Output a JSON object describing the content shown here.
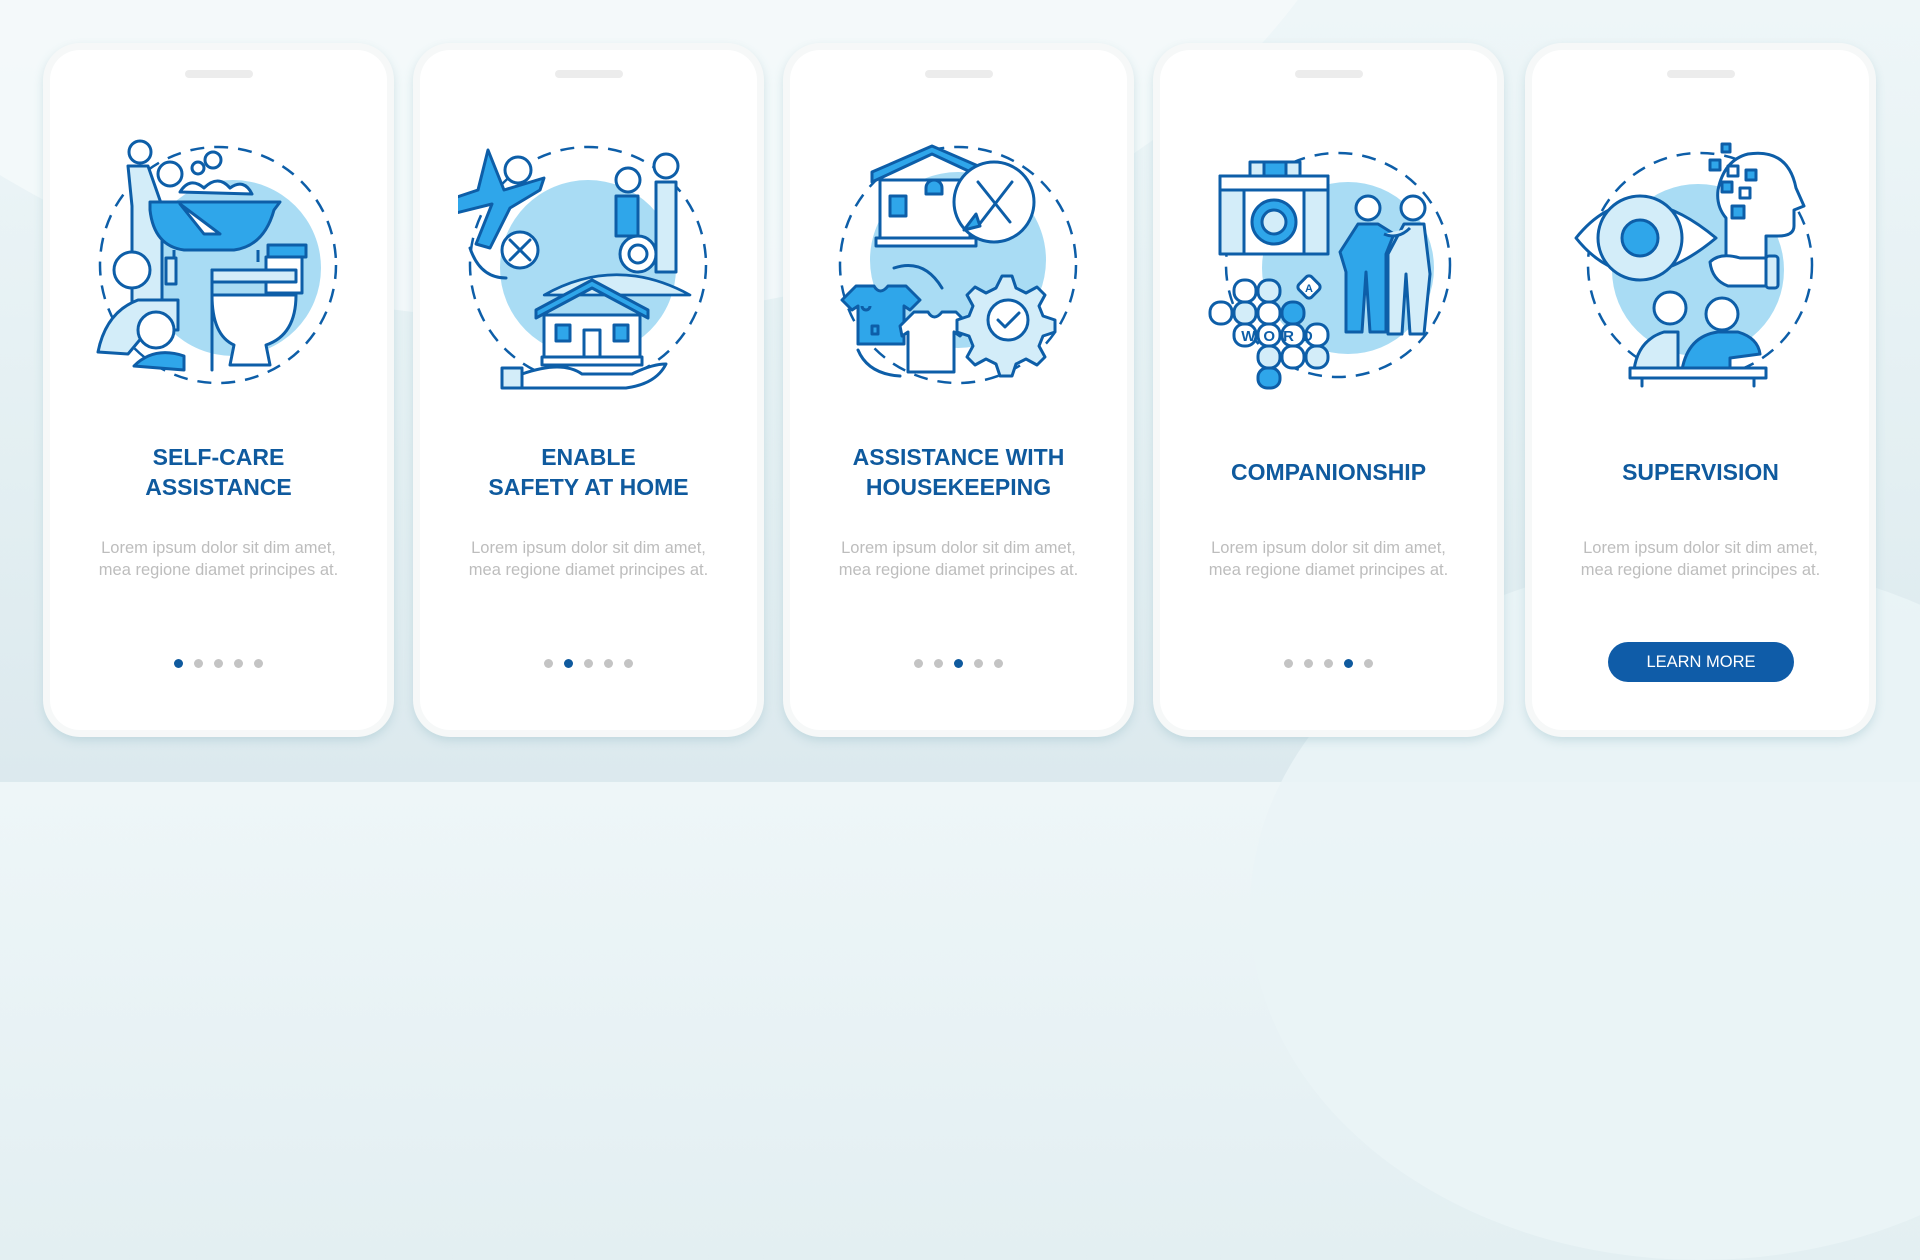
{
  "theme": {
    "accent": "#0f5a9e",
    "button": "#0f5ca8",
    "illustration_outline": "#0d5ea8",
    "illustration_fill": "#2fa6ea",
    "illustration_light": "#a9dcf4",
    "body_text": "#bdbdbd",
    "dot_inactive": "#c4c4c4"
  },
  "cards": [
    {
      "illustration": "self-care-bathing-grooming-toilet-icon",
      "title": "SELF-CARE\nASSISTANCE",
      "body": "Lorem ipsum dolor sit dim amet, mea regione diamet principes at.",
      "page_index": 1,
      "page_count": 5
    },
    {
      "illustration": "home-safety-fall-wheelchair-house-icon",
      "title": "ENABLE\nSAFETY AT HOME",
      "body": "Lorem ipsum dolor sit dim amet, mea regione diamet principes at.",
      "page_index": 2,
      "page_count": 5
    },
    {
      "illustration": "housekeeping-tools-laundry-gear-icon",
      "title": "ASSISTANCE WITH\nHOUSEKEEPING",
      "body": "Lorem ipsum dolor sit dim amet, mea regione diamet principes at.",
      "page_index": 3,
      "page_count": 5
    },
    {
      "illustration": "companionship-camera-crossword-friends-icon",
      "title": "COMPANIONSHIP",
      "body": "Lorem ipsum dolor sit dim amet, mea regione diamet principes at.",
      "page_index": 4,
      "page_count": 5
    },
    {
      "illustration": "supervision-eye-mind-people-icon",
      "title": "SUPERVISION",
      "body": "Lorem ipsum dolor sit dim amet, mea regione diamet principes at.",
      "button_label": "LEARN MORE"
    }
  ],
  "crossword_word": "WORD",
  "crossword_letter": "A"
}
